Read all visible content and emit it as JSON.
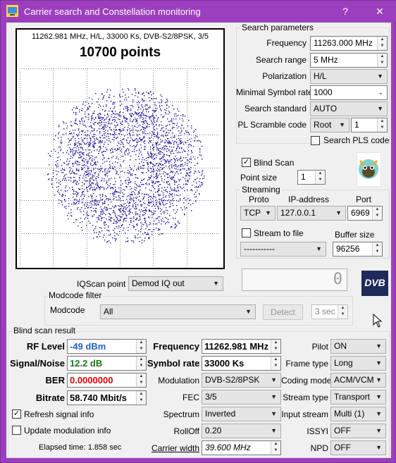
{
  "window": {
    "title": "Carrier search and Constellation monitoring",
    "help_label": "?",
    "close_label": "✕"
  },
  "constellation": {
    "info": "11262.981 MHz, H/L, 33000 Ks, DVB-S2/8PSK, 3/5",
    "points_label": "10700 points"
  },
  "search_params": {
    "title": "Search parameters",
    "frequency_label": "Frequency",
    "frequency_value": "11263.000 MHz",
    "search_range_label": "Search range",
    "search_range_value": "5 MHz",
    "polarization_label": "Polarization",
    "polarization_value": "H/L",
    "min_sr_label": "Minimal Symbol rate",
    "min_sr_value": "1000",
    "search_standard_label": "Search standard",
    "search_standard_value": "AUTO",
    "pl_scramble_label": "PL Scramble code",
    "pl_scramble_mode": "Root",
    "pl_scramble_value": "1",
    "search_pls_label": "Search PLS code"
  },
  "blind_scan": {
    "label": "Blind Scan",
    "point_size_label": "Point size",
    "point_size_value": "1"
  },
  "streaming": {
    "title": "Streaming",
    "proto_label": "Proto",
    "ip_label": "IP-address",
    "port_label": "Port",
    "proto_value": "TCP",
    "ip_value": "127.0.0.1",
    "port_value": "6969",
    "stream_to_file_label": "Stream to file",
    "buffer_size_label": "Buffer size",
    "file_value": "-----------",
    "buffer_value": "96256"
  },
  "iqscan": {
    "label": "IQScan point",
    "value": "Demod IQ out"
  },
  "lcd_value": "0",
  "dvb_logo_text": "DVB",
  "modcode_filter": {
    "title": "Modcode filter",
    "label": "Modcode",
    "value": "All",
    "detect_label": "Detect",
    "interval_value": "3 sec"
  },
  "result": {
    "title": "Blind scan result",
    "rf_level_label": "RF Level",
    "rf_level_value": "-49 dBm",
    "sn_label": "Signal/Noise",
    "sn_value": "12.2 dB",
    "ber_label": "BER",
    "ber_value": "0.0000000",
    "bitrate_label": "Bitrate",
    "bitrate_value": "58.740 Mbit/s",
    "frequency_label": "Frequency",
    "frequency_value": "11262.981 MHz",
    "symbol_rate_label": "Symbol rate",
    "symbol_rate_value": "33000 Ks",
    "modulation_label": "Modulation",
    "modulation_value": "DVB-S2/8PSK",
    "fec_label": "FEC",
    "fec_value": "3/5",
    "spectrum_label": "Spectrum",
    "spectrum_value": "Inverted",
    "rolloff_label": "RollOff",
    "rolloff_value": "0.20",
    "carrier_width_label": "Carrier width",
    "carrier_width_value": "39.600 MHz",
    "pilot_label": "Pilot",
    "pilot_value": "ON",
    "frame_type_label": "Frame type",
    "frame_type_value": "Long",
    "coding_mode_label": "Coding mode",
    "coding_mode_value": "ACM/VCM",
    "stream_type_label": "Stream type",
    "stream_type_value": "Transport",
    "input_stream_label": "Input stream",
    "input_stream_value": "Multi (1)",
    "issyi_label": "ISSYI",
    "issyi_value": "OFF",
    "npd_label": "NPD",
    "npd_value": "OFF",
    "refresh_label": "Refresh signal info",
    "update_mod_label": "Update modulation info",
    "elapsed_label": "Elapsed time: 1.858 sec"
  },
  "colors": {
    "title_bar": "#9c3fbf",
    "rf_level": "#1f5fd6",
    "snr": "#1a7a1a",
    "ber": "#e00000",
    "points": "#1a1aa8"
  }
}
